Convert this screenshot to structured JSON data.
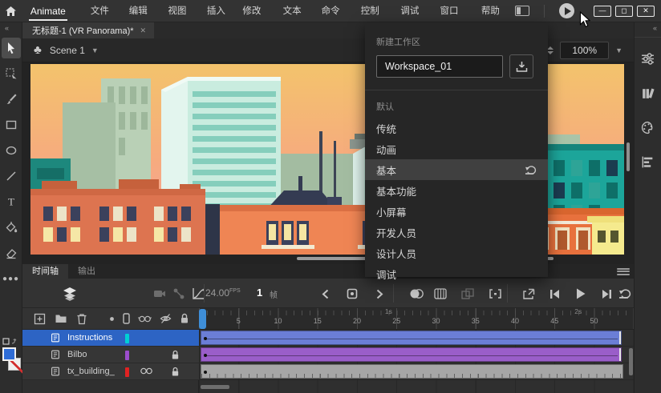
{
  "titlebar": {
    "app_name": "Animate",
    "menus": [
      "文件(F)",
      "编辑(E)",
      "视图(V)",
      "插入(I)",
      "修改(M)",
      "文本(T)",
      "命令(C)",
      "控制(O)",
      "调试(D)",
      "窗口(W)",
      "帮助(H)"
    ],
    "minimize": "—",
    "maximize": "◻",
    "close": "✕"
  },
  "document": {
    "tab_title": "无标题-1 (VR Panorama)*",
    "tab_close": "✕",
    "scene_label": "Scene 1",
    "zoom_value": "100%"
  },
  "workspace_menu": {
    "new_workspace_label": "新建工作区",
    "workspace_name_value": "Workspace_01",
    "section_label": "默认",
    "items": [
      {
        "label": "传统"
      },
      {
        "label": "动画"
      },
      {
        "label": "基本",
        "active": true
      },
      {
        "label": "基本功能"
      },
      {
        "label": "小屏幕"
      },
      {
        "label": "开发人员"
      },
      {
        "label": "设计人员"
      },
      {
        "label": "调试"
      }
    ]
  },
  "timeline": {
    "tab_timeline": "时间轴",
    "tab_output": "输出",
    "fps_value": "24.00",
    "fps_unit": "FPS",
    "current_frame": "1",
    "frame_unit": "帧",
    "ruler_numbers": [
      "5",
      "10",
      "15",
      "20",
      "25",
      "30",
      "35",
      "40",
      "45",
      "50"
    ],
    "time_markers": [
      {
        "label": "1s",
        "frame": 24
      },
      {
        "label": "2s",
        "frame": 48
      }
    ],
    "layers": [
      {
        "name": "Instructions",
        "color": "#00cfd4",
        "selected": true,
        "locked": false,
        "advanced": false,
        "span_color": "#6b7ed6"
      },
      {
        "name": "Bilbo",
        "color": "#9b4dcc",
        "selected": false,
        "locked": true,
        "advanced": false,
        "span_color": "#9a5ec9"
      },
      {
        "name": "tx_building_",
        "color": "#e02222",
        "selected": false,
        "locked": true,
        "advanced": true,
        "span_color": "#a6a6a6"
      }
    ]
  },
  "colors": {
    "selection_blue": "#2d64c4",
    "playhead_blue": "#3e8ed8",
    "fill_swatch": "#2e6cd6"
  }
}
